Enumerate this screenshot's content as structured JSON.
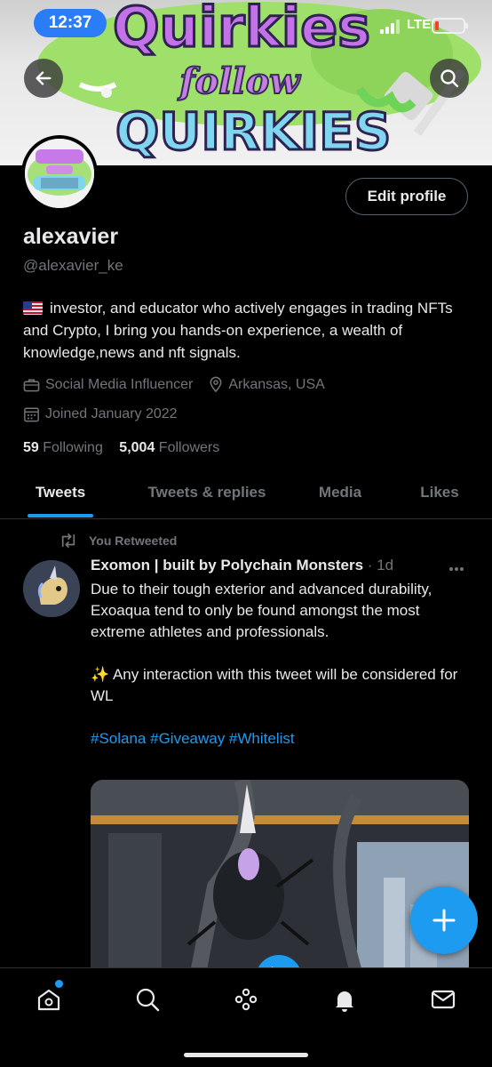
{
  "status_bar": {
    "time": "12:37",
    "network": "LTE"
  },
  "banner": {
    "line1": "Quirkies",
    "line2": "follow",
    "line3": "QUIRKIES"
  },
  "profile": {
    "edit_button_label": "Edit profile",
    "display_name": "alexavier",
    "handle": "@alexavier_ke",
    "bio": "investor, and educator who actively engages in trading NFTs and Crypto, I bring you hands-on experience, a wealth of knowledge,news and nft signals.",
    "category": "Social Media Influencer",
    "location": "Arkansas, USA",
    "joined": "Joined January 2022",
    "following_count": "59",
    "following_label": "Following",
    "followers_count": "5,004",
    "followers_label": "Followers"
  },
  "tabs": [
    {
      "label": "Tweets",
      "active": true
    },
    {
      "label": "Tweets & replies",
      "active": false
    },
    {
      "label": "Media",
      "active": false
    },
    {
      "label": "Likes",
      "active": false
    }
  ],
  "tweet": {
    "retweet_label": "You Retweeted",
    "author": "Exomon | built by Polychain Monsters",
    "time": "· 1d",
    "paragraph1": "Due to their tough exterior and advanced durability, Exoaqua tend to only be found amongst the most extreme athletes and professionals.",
    "paragraph2": "Any interaction with this tweet will be considered for WL",
    "hashtags": "#Solana #Giveaway #Whitelist"
  },
  "icons": {
    "back": "arrow-left-icon",
    "search": "search-icon",
    "compose": "plus-icon",
    "nav": [
      "home-icon",
      "search-icon",
      "spaces-icon",
      "bell-icon",
      "mail-icon"
    ]
  },
  "colors": {
    "accent": "#1d9bf0",
    "background": "#000000",
    "muted": "#71767b",
    "time_pill": "#2a7cf7"
  }
}
